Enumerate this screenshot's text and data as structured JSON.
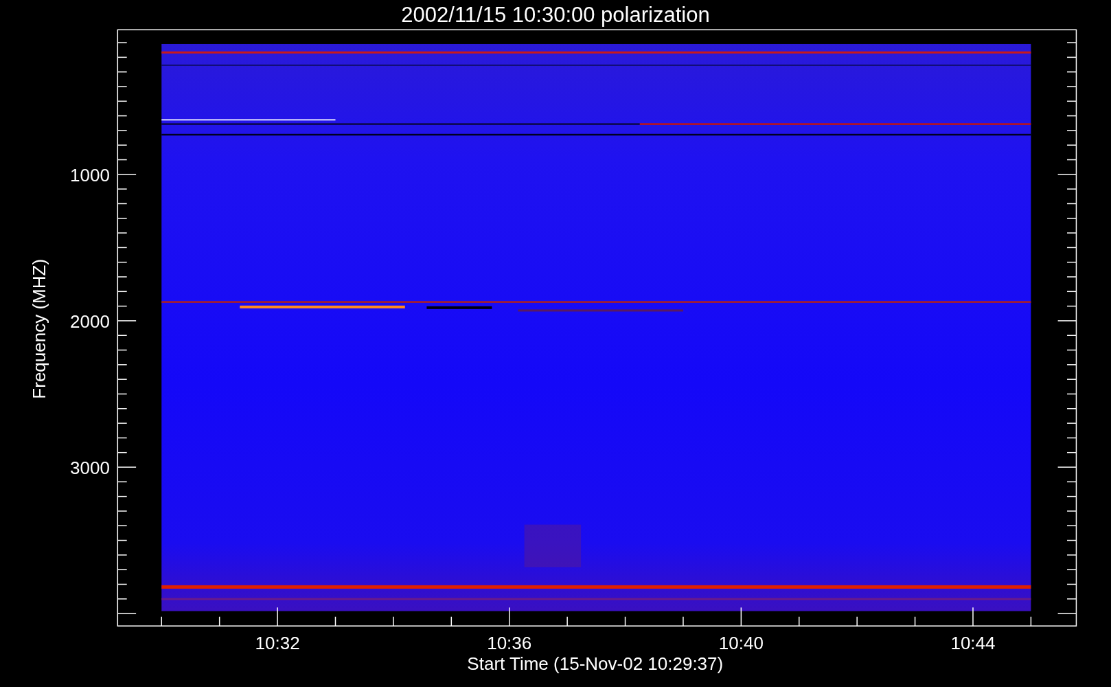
{
  "title": "2002/11/15 10:30:00 polarization",
  "y_axis": {
    "label": "Frequency (MHZ)",
    "ticks": [
      "1000",
      "2000",
      "3000"
    ]
  },
  "x_axis": {
    "label": "Start Time (15-Nov-02 10:29:37)",
    "ticks": [
      "10:32",
      "10:36",
      "10:40",
      "10:44"
    ]
  }
}
